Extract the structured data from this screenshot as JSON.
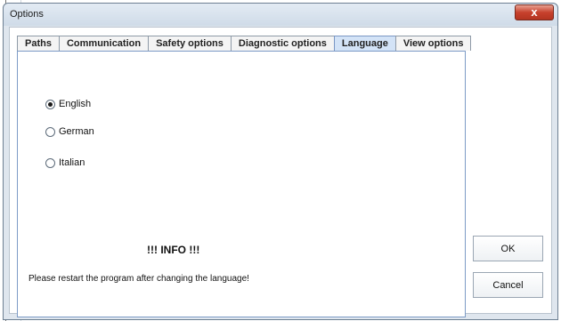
{
  "window": {
    "title": "Options",
    "close_label": "x"
  },
  "tabs": [
    {
      "label": "Paths",
      "active": false
    },
    {
      "label": "Communication",
      "active": false
    },
    {
      "label": "Safety options",
      "active": false
    },
    {
      "label": "Diagnostic options",
      "active": false
    },
    {
      "label": "Language",
      "active": true
    },
    {
      "label": "View options",
      "active": false
    }
  ],
  "language": {
    "options": [
      {
        "label": "English",
        "selected": true
      },
      {
        "label": "German",
        "selected": false
      },
      {
        "label": "Italian",
        "selected": false
      }
    ],
    "info_title": "!!! INFO !!!",
    "info_text": "Please restart the program after changing the language!"
  },
  "buttons": {
    "ok": "OK",
    "cancel": "Cancel"
  },
  "colors": {
    "active_tab": "#d3e3f7",
    "close_button": "#c7412d"
  }
}
